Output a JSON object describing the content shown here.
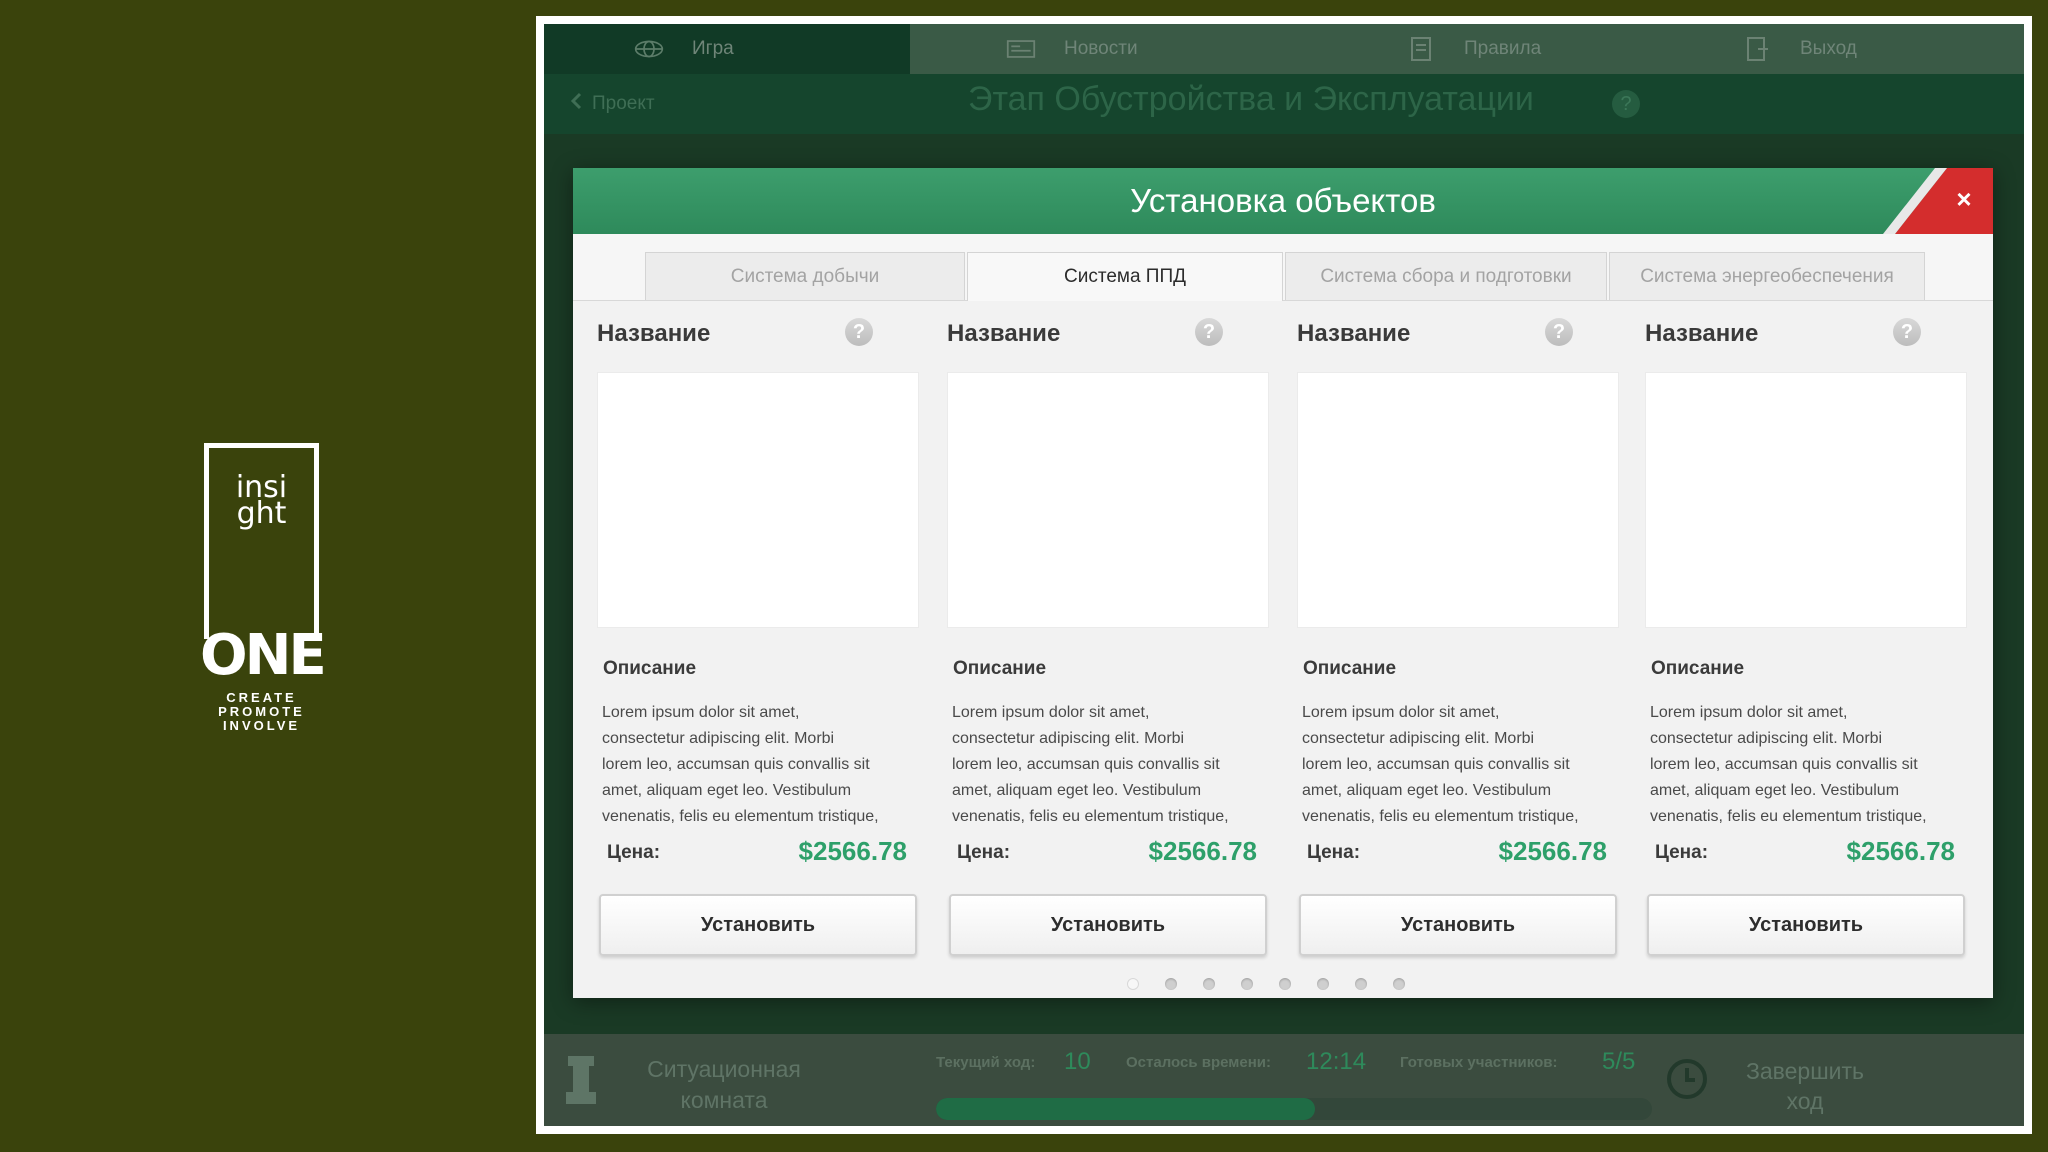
{
  "brand": {
    "line1": "insi",
    "line2": "ght",
    "name": "ONE",
    "tagline": [
      "CREATE",
      "PROMOTE",
      "INVOLVE"
    ]
  },
  "nav": {
    "items": [
      {
        "label": "Игра",
        "icon": "globe-icon",
        "active": true
      },
      {
        "label": "Новости",
        "icon": "news-icon",
        "active": false
      },
      {
        "label": "Правила",
        "icon": "rules-icon",
        "active": false
      },
      {
        "label": "Выход",
        "icon": "exit-icon",
        "active": false
      }
    ]
  },
  "subbar": {
    "back_label": "Проект",
    "title": "Этап Обустройства и Эксплуатации",
    "help": "?"
  },
  "modal": {
    "title": "Установка объектов",
    "close": "×",
    "tabs": [
      {
        "label": "Система добычи",
        "active": false
      },
      {
        "label": "Система ППД",
        "active": true
      },
      {
        "label": "Система сбора и подготовки",
        "active": false
      },
      {
        "label": "Система энергеобеспечения",
        "active": false
      }
    ],
    "cards": [
      {
        "name": "Название",
        "help": "?",
        "desc_label": "Описание",
        "desc": [
          "Lorem ipsum dolor sit amet,",
          "consectetur adipiscing elit. Morbi",
          "lorem leo, accumsan quis convallis sit",
          "amet, aliquam eget leo. Vestibulum",
          "venenatis, felis eu elementum tristique,"
        ],
        "price_label": "Цена:",
        "price": "$2566.78",
        "button": "Установить"
      },
      {
        "name": "Название",
        "help": "?",
        "desc_label": "Описание",
        "desc": [
          "Lorem ipsum dolor sit amet,",
          "consectetur adipiscing elit. Morbi",
          "lorem leo, accumsan quis convallis sit",
          "amet, aliquam eget leo. Vestibulum",
          "venenatis, felis eu elementum tristique,"
        ],
        "price_label": "Цена:",
        "price": "$2566.78",
        "button": "Установить"
      },
      {
        "name": "Название",
        "help": "?",
        "desc_label": "Описание",
        "desc": [
          "Lorem ipsum dolor sit amet,",
          "consectetur adipiscing elit. Morbi",
          "lorem leo, accumsan quis convallis sit",
          "amet, aliquam eget leo. Vestibulum",
          "venenatis, felis eu elementum tristique,"
        ],
        "price_label": "Цена:",
        "price": "$2566.78",
        "button": "Установить"
      },
      {
        "name": "Название",
        "help": "?",
        "desc_label": "Описание",
        "desc": [
          "Lorem ipsum dolor sit amet,",
          "consectetur adipiscing elit. Morbi",
          "lorem leo, accumsan quis convallis sit",
          "amet, aliquam eget leo. Vestibulum",
          "venenatis, felis eu elementum tristique,"
        ],
        "price_label": "Цена:",
        "price": "$2566.78",
        "button": "Установить"
      }
    ],
    "pagination": {
      "pages": 8,
      "current": 1
    }
  },
  "bottombar": {
    "situation_line1": "Ситуационная",
    "situation_line2": "комната",
    "turn_label": "Текущий ход:",
    "turn_value": "10",
    "time_label": "Осталось времени:",
    "time_value": "12:14",
    "ready_label": "Готовых участников:",
    "ready_value": "5/5",
    "progress": 0.53,
    "finish_line1": "Завершить",
    "finish_line2": "ход"
  },
  "colors": {
    "page_bg": "#3a430c",
    "accent_green": "#2e8a5b",
    "price_green": "#2ea06a",
    "close_red": "#d42d2d"
  }
}
